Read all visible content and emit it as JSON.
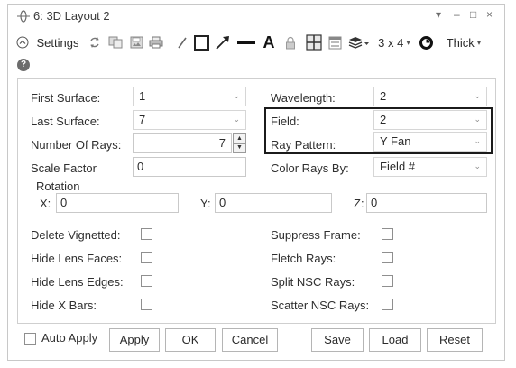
{
  "window": {
    "title": "6: 3D Layout 2",
    "controls": {
      "dropdown": "▾",
      "minimize": "–",
      "maximize": "□",
      "close": "×"
    }
  },
  "toolbar": {
    "settings_label": "Settings",
    "layout_label": "3 x 4",
    "thickness_label": "Thick",
    "icons": [
      "collapse-icon",
      "refresh-icon",
      "copy-icon",
      "save-icon",
      "print-icon",
      "pencil-icon",
      "rectangle-icon",
      "arrow-icon",
      "line-icon",
      "text-icon",
      "lock-icon",
      "grid-icon",
      "window-icon",
      "layers-icon",
      "timer-icon"
    ]
  },
  "form": {
    "first_surface": {
      "label": "First Surface:",
      "value": "1"
    },
    "last_surface": {
      "label": "Last Surface:",
      "value": "7"
    },
    "number_of_rays": {
      "label": "Number Of Rays:",
      "value": "7"
    },
    "scale_factor": {
      "label": "Scale Factor",
      "value": "0"
    },
    "wavelength": {
      "label": "Wavelength:",
      "value": "2"
    },
    "field": {
      "label": "Field:",
      "value": "2"
    },
    "ray_pattern": {
      "label": "Ray Pattern:",
      "value": "Y Fan"
    },
    "color_rays_by": {
      "label": "Color Rays By:",
      "value": "Field #"
    },
    "rotation": {
      "label": "Rotation",
      "x_label": "X:",
      "x_value": "0",
      "y_label": "Y:",
      "y_value": "0",
      "z_label": "Z:",
      "z_value": "0"
    },
    "checkboxes_left": [
      "Delete Vignetted:",
      "Hide Lens Faces:",
      "Hide Lens Edges:",
      "Hide X Bars:"
    ],
    "checkboxes_right": [
      "Suppress Frame:",
      "Fletch Rays:",
      "Split NSC Rays:",
      "Scatter NSC Rays:"
    ]
  },
  "buttons": {
    "auto_apply": "Auto Apply",
    "apply": "Apply",
    "ok": "OK",
    "cancel": "Cancel",
    "save": "Save",
    "load": "Load",
    "reset": "Reset"
  },
  "colors": {
    "highlight_border": "#1b1b1b",
    "panel_border": "#cfcfcf"
  }
}
